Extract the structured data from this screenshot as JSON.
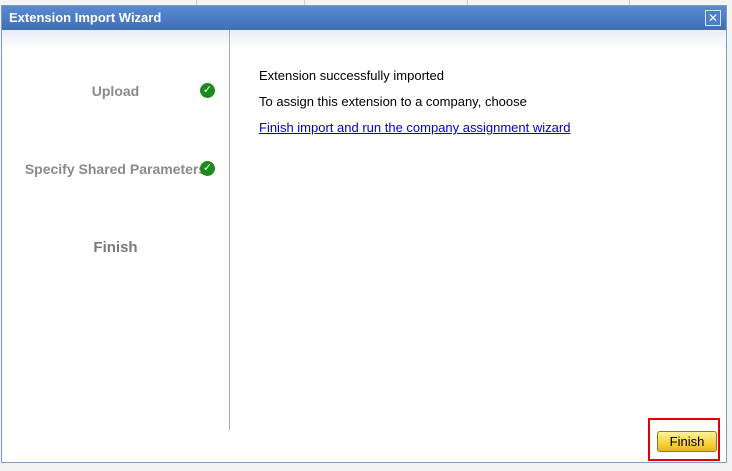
{
  "dialog": {
    "title": "Extension Import Wizard",
    "close_label": "✕"
  },
  "steps": [
    {
      "label": "Upload",
      "status": "complete"
    },
    {
      "label": "Specify Shared Parameters",
      "status": "complete"
    },
    {
      "label": "Finish",
      "status": "current"
    }
  ],
  "content": {
    "message_1": "Extension successfully imported",
    "message_2": "To assign this extension to a company, choose",
    "link_label": "Finish import and run the company assignment wizard"
  },
  "footer": {
    "finish_label": "Finish"
  },
  "colors": {
    "titlebar": "#4a7cc4",
    "check": "#1d8a1d",
    "link": "#0000cc",
    "highlight": "#e00000",
    "button": "#f7d23a"
  }
}
